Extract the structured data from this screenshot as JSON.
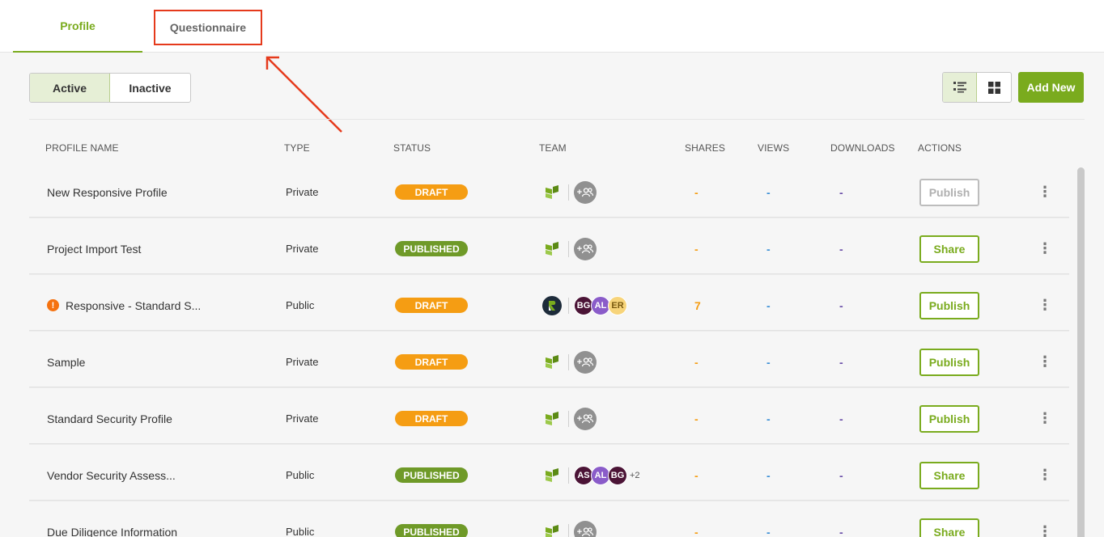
{
  "tabs": [
    {
      "label": "Profile",
      "active": true
    },
    {
      "label": "Questionnaire",
      "active": false
    }
  ],
  "filters": {
    "active_label": "Active",
    "inactive_label": "Inactive",
    "selected": "Active"
  },
  "view_toggle": {
    "list_icon": "list-view-icon",
    "grid_icon": "grid-view-icon",
    "selected": "list"
  },
  "add_new_label": "Add New",
  "columns": {
    "name": "PROFILE NAME",
    "type": "TYPE",
    "status": "STATUS",
    "team": "TEAM",
    "shares": "SHARES",
    "views": "VIEWS",
    "downloads": "DOWNLOADS",
    "actions": "ACTIONS"
  },
  "rows": [
    {
      "name": "New Responsive Profile",
      "type": "Private",
      "status": "DRAFT",
      "shares": "-",
      "views": "-",
      "downloads": "-",
      "action": "Publish"
    },
    {
      "name": "Project Import Test",
      "type": "Private",
      "status": "PUBLISHED",
      "shares": "-",
      "views": "-",
      "downloads": "-",
      "action": "Share"
    },
    {
      "name": "Responsive - Standard S...",
      "type": "Public",
      "status": "DRAFT",
      "shares": "7",
      "views": "-",
      "downloads": "-",
      "action": "Publish",
      "avatars": [
        "BG",
        "AL",
        "ER"
      ]
    },
    {
      "name": "Sample",
      "type": "Private",
      "status": "DRAFT",
      "shares": "-",
      "views": "-",
      "downloads": "-",
      "action": "Publish"
    },
    {
      "name": "Standard Security Profile",
      "type": "Private",
      "status": "DRAFT",
      "shares": "-",
      "views": "-",
      "downloads": "-",
      "action": "Publish"
    },
    {
      "name": "Vendor Security Assess...",
      "type": "Public",
      "status": "PUBLISHED",
      "shares": "-",
      "views": "-",
      "downloads": "-",
      "action": "Share",
      "avatars": [
        "AS",
        "AL",
        "BG"
      ],
      "more": "+2"
    },
    {
      "name": "Due Diligence Information",
      "type": "Public",
      "status": "PUBLISHED",
      "shares": "-",
      "views": "-",
      "downloads": "-",
      "action": "Share"
    }
  ],
  "colors": {
    "brand_green": "#7aab1e",
    "draft": "#f59d13",
    "published": "#6f9a28",
    "highlight_red": "#e53a1c",
    "avatar_BG": "#4b1436",
    "avatar_AL": "#8a5cc9",
    "avatar_ER": "#f7d47a",
    "avatar_AS": "#4b1436"
  }
}
